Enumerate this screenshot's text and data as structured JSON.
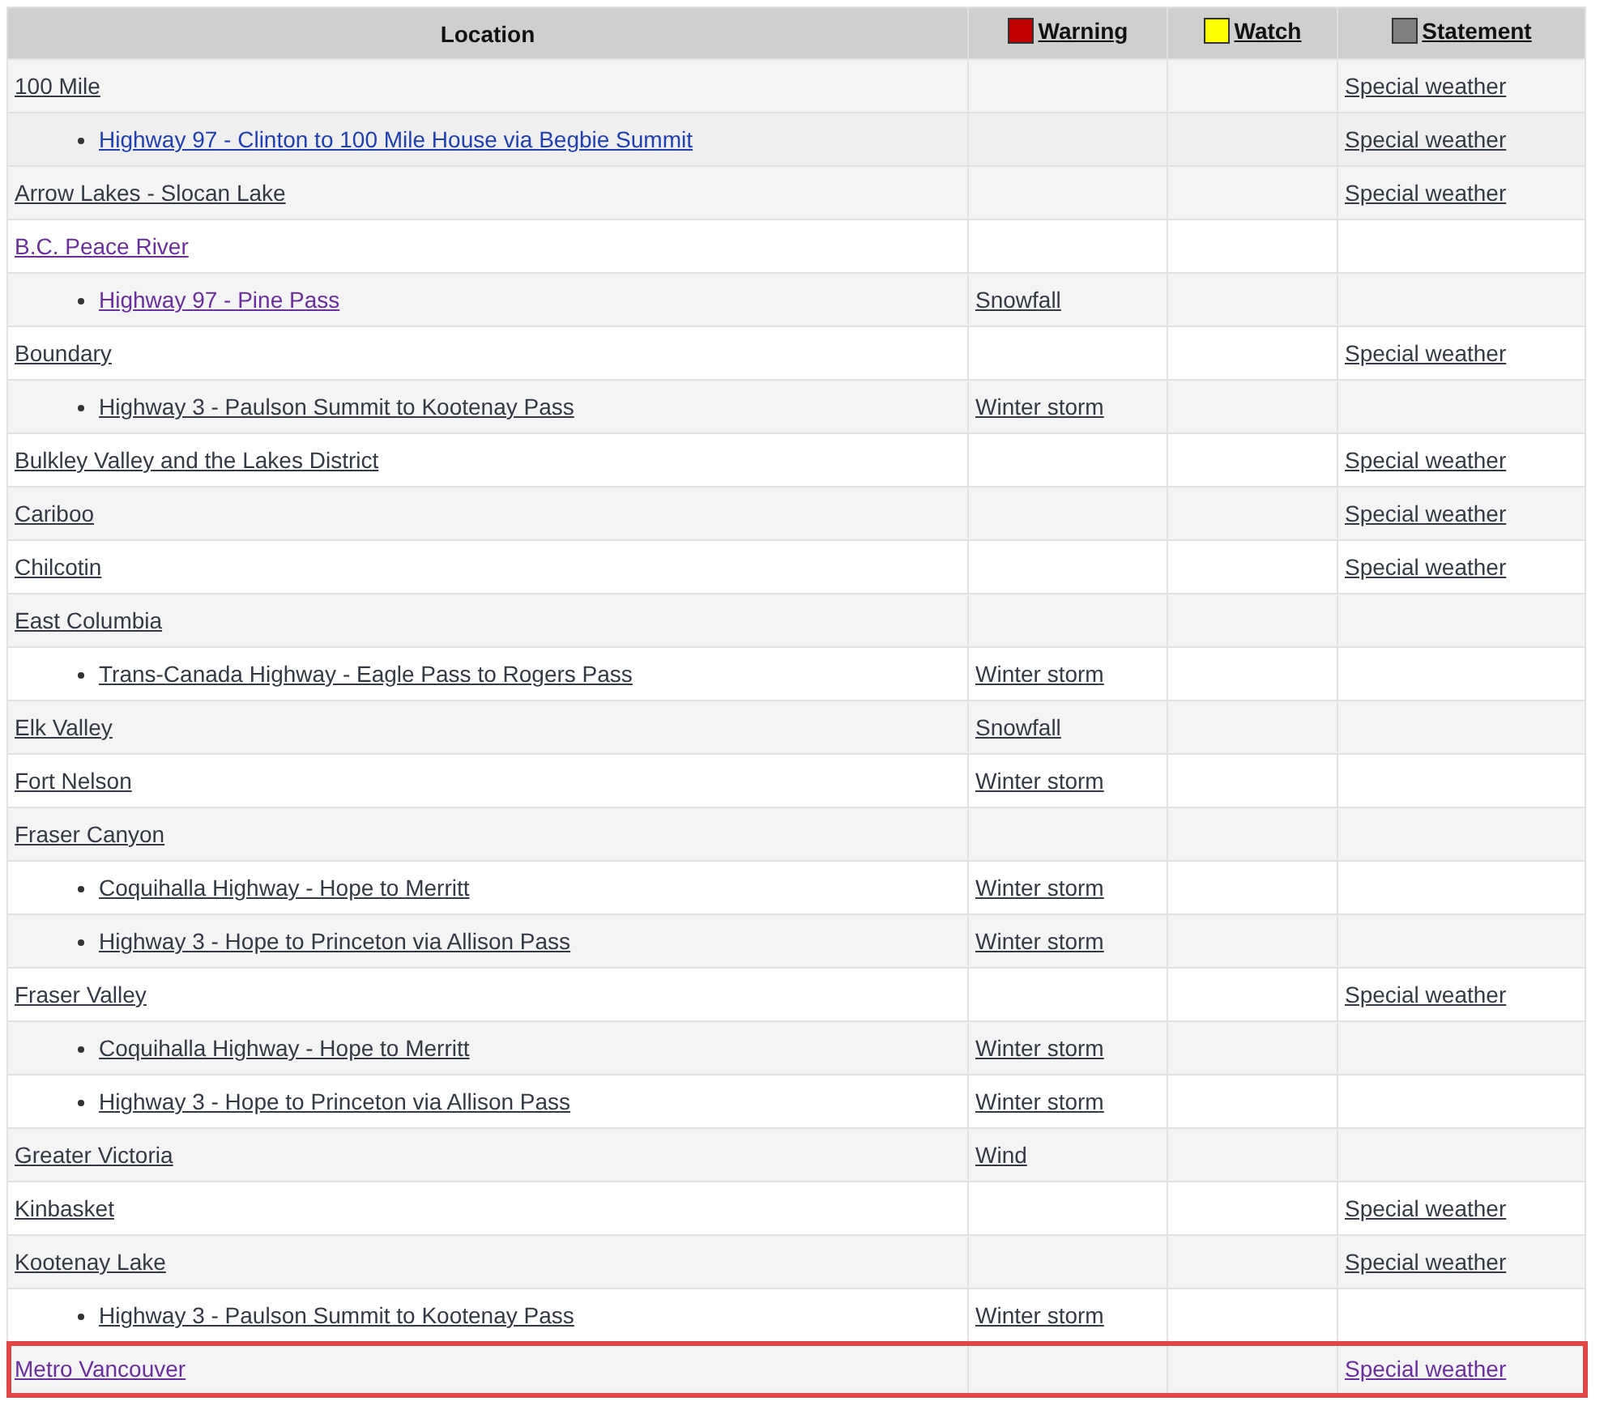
{
  "table": {
    "columns": [
      {
        "label": "Location"
      },
      {
        "label": "Warning",
        "color": "#c00000"
      },
      {
        "label": "Watch",
        "color": "#ffff00"
      },
      {
        "label": "Statement",
        "color": "#808080"
      }
    ],
    "rows": [
      {
        "kind": "region",
        "selected": false,
        "location": {
          "text": "100 Mile",
          "visited": false,
          "hovered": false
        },
        "statement": {
          "text": "Special weather",
          "visited": false,
          "hovered": false
        }
      },
      {
        "kind": "highway",
        "selected": false,
        "location": {
          "text": "Highway 97 - Clinton to 100 Mile House via Begbie Summit",
          "visited": false,
          "hovered": true
        },
        "statement": {
          "text": "Special weather",
          "visited": false,
          "hovered": false
        }
      },
      {
        "kind": "region",
        "selected": false,
        "location": {
          "text": "Arrow Lakes - Slocan Lake",
          "visited": false,
          "hovered": false
        },
        "statement": {
          "text": "Special weather",
          "visited": false,
          "hovered": false
        }
      },
      {
        "kind": "region",
        "selected": false,
        "location": {
          "text": "B.C. Peace River",
          "visited": true,
          "hovered": false
        }
      },
      {
        "kind": "highway",
        "selected": false,
        "location": {
          "text": "Highway 97 - Pine Pass",
          "visited": true,
          "hovered": false
        },
        "warning": {
          "text": "Snowfall",
          "visited": false,
          "hovered": false
        }
      },
      {
        "kind": "region",
        "selected": false,
        "location": {
          "text": "Boundary",
          "visited": false,
          "hovered": false
        },
        "statement": {
          "text": "Special weather",
          "visited": false,
          "hovered": false
        }
      },
      {
        "kind": "highway",
        "selected": false,
        "location": {
          "text": "Highway 3 - Paulson Summit to Kootenay Pass",
          "visited": false,
          "hovered": false
        },
        "warning": {
          "text": "Winter storm",
          "visited": false,
          "hovered": false
        }
      },
      {
        "kind": "region",
        "selected": false,
        "location": {
          "text": "Bulkley Valley and the Lakes District",
          "visited": false,
          "hovered": false
        },
        "statement": {
          "text": "Special weather",
          "visited": false,
          "hovered": false
        }
      },
      {
        "kind": "region",
        "selected": false,
        "location": {
          "text": "Cariboo",
          "visited": false,
          "hovered": false
        },
        "statement": {
          "text": "Special weather",
          "visited": false,
          "hovered": false
        }
      },
      {
        "kind": "region",
        "selected": false,
        "location": {
          "text": "Chilcotin",
          "visited": false,
          "hovered": false
        },
        "statement": {
          "text": "Special weather",
          "visited": false,
          "hovered": false
        }
      },
      {
        "kind": "region",
        "selected": false,
        "location": {
          "text": "East Columbia",
          "visited": false,
          "hovered": false
        }
      },
      {
        "kind": "highway",
        "selected": false,
        "location": {
          "text": "Trans-Canada Highway - Eagle Pass to Rogers Pass",
          "visited": false,
          "hovered": false
        },
        "warning": {
          "text": "Winter storm",
          "visited": false,
          "hovered": false
        }
      },
      {
        "kind": "region",
        "selected": false,
        "location": {
          "text": "Elk Valley",
          "visited": false,
          "hovered": false
        },
        "warning": {
          "text": "Snowfall",
          "visited": false,
          "hovered": false
        }
      },
      {
        "kind": "region",
        "selected": false,
        "location": {
          "text": "Fort Nelson",
          "visited": false,
          "hovered": false
        },
        "warning": {
          "text": "Winter storm",
          "visited": false,
          "hovered": false
        }
      },
      {
        "kind": "region",
        "selected": false,
        "location": {
          "text": "Fraser Canyon",
          "visited": false,
          "hovered": false
        }
      },
      {
        "kind": "highway",
        "selected": false,
        "location": {
          "text": "Coquihalla Highway - Hope to Merritt",
          "visited": false,
          "hovered": false
        },
        "warning": {
          "text": "Winter storm",
          "visited": false,
          "hovered": false
        }
      },
      {
        "kind": "highway",
        "selected": false,
        "location": {
          "text": "Highway 3 - Hope to Princeton via Allison Pass",
          "visited": false,
          "hovered": false
        },
        "warning": {
          "text": "Winter storm",
          "visited": false,
          "hovered": false
        }
      },
      {
        "kind": "region",
        "selected": false,
        "location": {
          "text": "Fraser Valley",
          "visited": false,
          "hovered": false
        },
        "statement": {
          "text": "Special weather",
          "visited": false,
          "hovered": false
        }
      },
      {
        "kind": "highway",
        "selected": false,
        "location": {
          "text": "Coquihalla Highway - Hope to Merritt",
          "visited": false,
          "hovered": false
        },
        "warning": {
          "text": "Winter storm",
          "visited": false,
          "hovered": false
        }
      },
      {
        "kind": "highway",
        "selected": false,
        "location": {
          "text": "Highway 3 - Hope to Princeton via Allison Pass",
          "visited": false,
          "hovered": false
        },
        "warning": {
          "text": "Winter storm",
          "visited": false,
          "hovered": false
        }
      },
      {
        "kind": "region",
        "selected": false,
        "location": {
          "text": "Greater Victoria",
          "visited": false,
          "hovered": false
        },
        "warning": {
          "text": "Wind",
          "visited": false,
          "hovered": false
        }
      },
      {
        "kind": "region",
        "selected": false,
        "location": {
          "text": "Kinbasket",
          "visited": false,
          "hovered": false
        },
        "statement": {
          "text": "Special weather",
          "visited": false,
          "hovered": false
        }
      },
      {
        "kind": "region",
        "selected": false,
        "location": {
          "text": "Kootenay Lake",
          "visited": false,
          "hovered": false
        },
        "statement": {
          "text": "Special weather",
          "visited": false,
          "hovered": false
        }
      },
      {
        "kind": "highway",
        "selected": false,
        "location": {
          "text": "Highway 3 - Paulson Summit to Kootenay Pass",
          "visited": false,
          "hovered": false
        },
        "warning": {
          "text": "Winter storm",
          "visited": false,
          "hovered": false
        }
      },
      {
        "kind": "region",
        "selected": true,
        "location": {
          "text": "Metro Vancouver",
          "visited": true,
          "hovered": false
        },
        "statement": {
          "text": "Special weather",
          "visited": true,
          "hovered": false
        }
      }
    ]
  }
}
